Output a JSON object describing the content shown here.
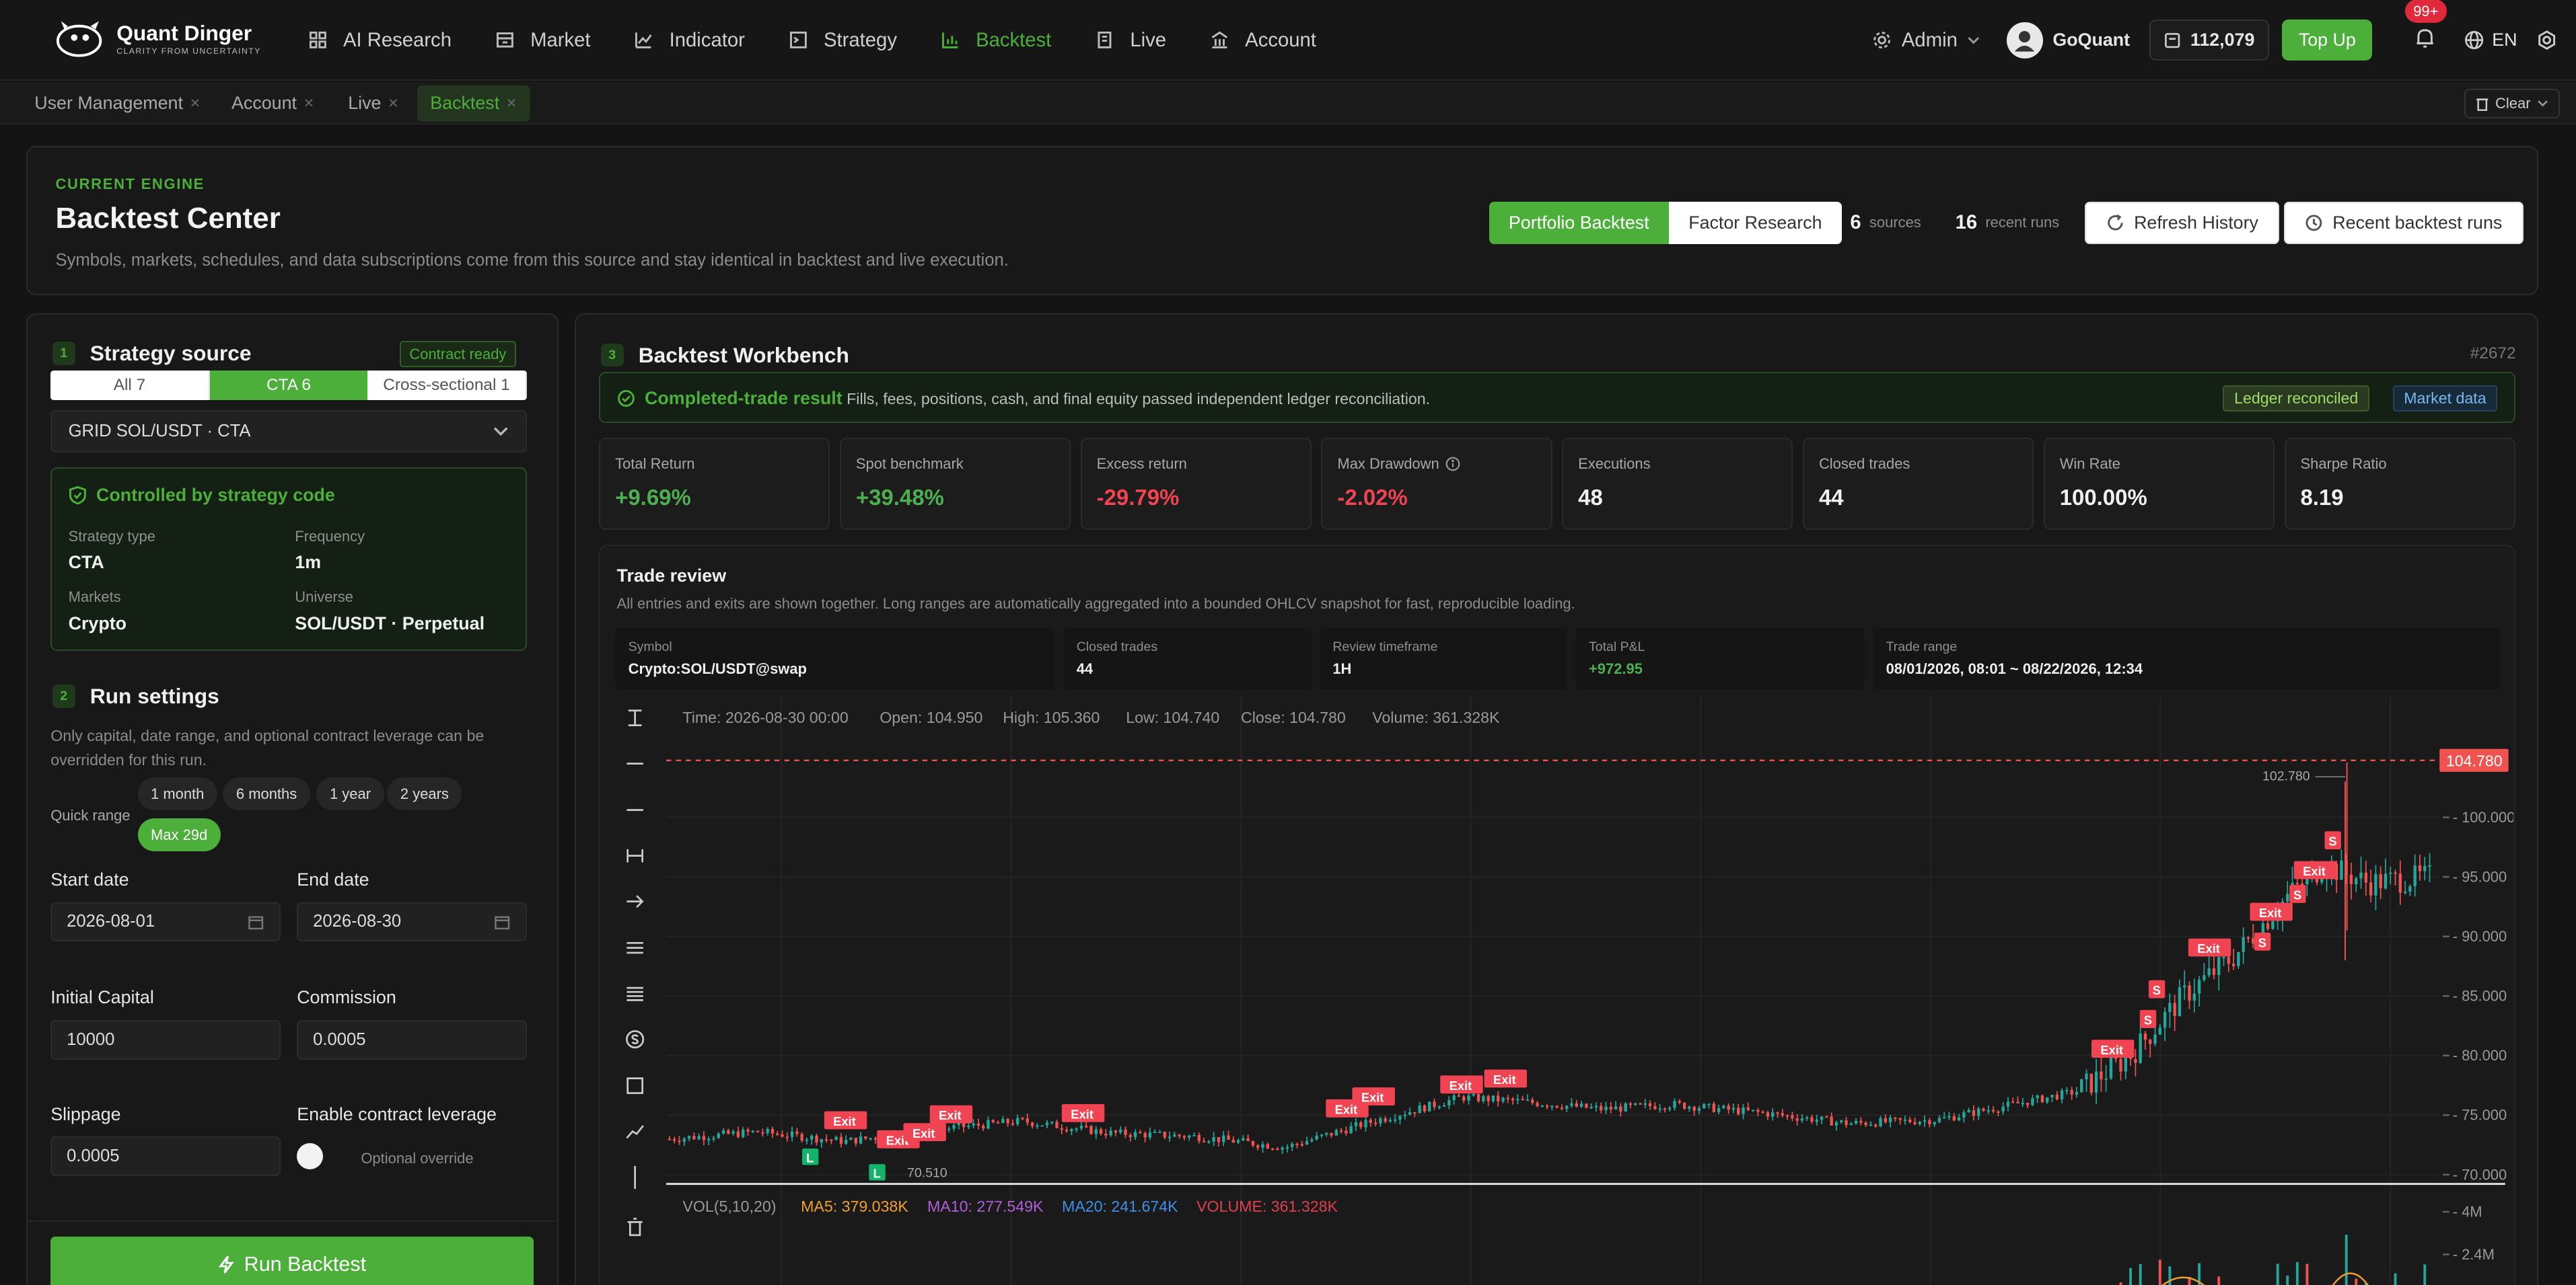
{
  "brand": {
    "name": "Quant Dinger",
    "tagline": "CLARITY FROM UNCERTAINTY"
  },
  "nav": [
    {
      "label": "AI Research",
      "icon": "grid-icon"
    },
    {
      "label": "Market",
      "icon": "store-icon"
    },
    {
      "label": "Indicator",
      "icon": "line-chart-icon"
    },
    {
      "label": "Strategy",
      "icon": "terminal-icon"
    },
    {
      "label": "Backtest",
      "icon": "bar-chart-icon"
    },
    {
      "label": "Live",
      "icon": "building-icon"
    },
    {
      "label": "Account",
      "icon": "bank-icon"
    }
  ],
  "topbar": {
    "admin": "Admin",
    "user": "GoQuant",
    "credits": "112,079",
    "topup": "Top Up",
    "notifications": "99+",
    "language": "EN"
  },
  "tabs": [
    "User Management",
    "Account",
    "Live",
    "Backtest"
  ],
  "clear_label": "Clear",
  "header": {
    "engine": "CURRENT ENGINE",
    "title": "Backtest Center",
    "subtitle": "Symbols, markets, schedules, and data subscriptions come from this source and stay identical in backtest and live execution.",
    "modes": [
      "Portfolio Backtest",
      "Factor Research"
    ],
    "sources_count": "6",
    "sources_label": "sources",
    "runs_count": "16",
    "runs_label": "recent runs",
    "refresh": "Refresh History",
    "recent": "Recent backtest runs"
  },
  "source": {
    "step": "1",
    "title": "Strategy source",
    "status": "Contract ready",
    "filters": [
      "All 7",
      "CTA 6",
      "Cross-sectional 1"
    ],
    "selected": "GRID SOL/USDT · CTA",
    "controlled": "Controlled by strategy code",
    "fields": [
      {
        "k": "Strategy type",
        "v": "CTA"
      },
      {
        "k": "Frequency",
        "v": "1m"
      },
      {
        "k": "Markets",
        "v": "Crypto"
      },
      {
        "k": "Universe",
        "v": "SOL/USDT · Perpetual"
      }
    ]
  },
  "run": {
    "step": "2",
    "title": "Run settings",
    "hint": "Only capital, date range, and optional contract leverage can be overridden for this run.",
    "quick_range": "Quick range",
    "ranges": [
      "1 month",
      "6 months",
      "1 year",
      "2 years",
      "Max 29d"
    ],
    "start_label": "Start date",
    "start": "2026-08-01",
    "end_label": "End date",
    "end": "2026-08-30",
    "capital_label": "Initial Capital",
    "capital": "10000",
    "commission_label": "Commission",
    "commission": "0.0005",
    "slippage_label": "Slippage",
    "slippage": "0.0005",
    "leverage_label": "Enable contract leverage",
    "leverage_hint": "Optional override",
    "run_button": "Run Backtest"
  },
  "workbench": {
    "step": "3",
    "title": "Backtest Workbench",
    "run_id": "#2672",
    "result_title": "Completed-trade result",
    "result_text": "Fills, fees, positions, cash, and final equity passed independent ledger reconciliation.",
    "tags": [
      "Ledger reconciled",
      "Market data"
    ],
    "metrics": [
      {
        "label": "Total Return",
        "value": "+9.69%",
        "color": "#4caf50"
      },
      {
        "label": "Spot benchmark",
        "value": "+39.48%",
        "color": "#4caf50"
      },
      {
        "label": "Excess return",
        "value": "-29.79%",
        "color": "#f04452"
      },
      {
        "label": "Max Drawdown",
        "value": "-2.02%",
        "color": "#f04452"
      },
      {
        "label": "Executions",
        "value": "48",
        "color": "#f0f0f0"
      },
      {
        "label": "Closed trades",
        "value": "44",
        "color": "#f0f0f0"
      },
      {
        "label": "Win Rate",
        "value": "100.00%",
        "color": "#f0f0f0"
      },
      {
        "label": "Sharpe Ratio",
        "value": "8.19",
        "color": "#f0f0f0"
      }
    ],
    "review_title": "Trade review",
    "review_sub": "All entries and exits are shown together. Long ranges are automatically aggregated into a bounded OHLCV snapshot for fast, reproducible loading.",
    "info": [
      {
        "k": "Symbol",
        "v": "Crypto:SOL/USDT@swap"
      },
      {
        "k": "Closed trades",
        "v": "44"
      },
      {
        "k": "Review timeframe",
        "v": "1H"
      },
      {
        "k": "Total P&L",
        "v": "+972.95"
      },
      {
        "k": "Trade range",
        "v": "08/01/2026, 08:01 ~ 08/22/2026, 12:34"
      }
    ]
  },
  "chart_data": {
    "type": "candlestick",
    "ohlc_label": {
      "time": "Time: 2026-08-30 00:00",
      "open": "Open: 104.950",
      "high": "High: 105.360",
      "low": "Low: 104.740",
      "close": "Close: 104.780",
      "volume": "Volume: 361.328K"
    },
    "last_price": "104.780",
    "max_label": "102.780",
    "min_label": "70.510",
    "y_ticks": [
      "100.000",
      "95.000",
      "90.000",
      "85.000",
      "80.000",
      "75.000",
      "70.000"
    ],
    "ylim": [
      69.5,
      106
    ],
    "close_path": [
      [
        0,
        73.0
      ],
      [
        0.05,
        73.6
      ],
      [
        0.1,
        72.8
      ],
      [
        0.15,
        73.8
      ],
      [
        0.2,
        74.5
      ],
      [
        0.25,
        73.5
      ],
      [
        0.3,
        73.2
      ],
      [
        0.35,
        72.3
      ],
      [
        0.4,
        74.5
      ],
      [
        0.45,
        76.5
      ],
      [
        0.48,
        76.2
      ],
      [
        0.53,
        75.5
      ],
      [
        0.57,
        75.9
      ],
      [
        0.62,
        75.2
      ],
      [
        0.67,
        74.3
      ],
      [
        0.72,
        74.6
      ],
      [
        0.76,
        75.8
      ],
      [
        0.8,
        77.0
      ],
      [
        0.83,
        80.0
      ],
      [
        0.86,
        85.0
      ],
      [
        0.89,
        88.5
      ],
      [
        0.92,
        93.5
      ],
      [
        0.94,
        96.0
      ],
      [
        0.965,
        94.5
      ],
      [
        1.0,
        95.0
      ]
    ],
    "markers": [
      {
        "x": 0.1,
        "p": 74.5,
        "label": "Exit",
        "type": "exit"
      },
      {
        "x": 0.13,
        "p": 72.9,
        "label": "Exit",
        "type": "exit"
      },
      {
        "x": 0.145,
        "p": 73.5,
        "label": "Exit",
        "type": "exit"
      },
      {
        "x": 0.16,
        "p": 75.0,
        "label": "Exit",
        "type": "exit"
      },
      {
        "x": 0.235,
        "p": 75.1,
        "label": "Exit",
        "type": "exit"
      },
      {
        "x": 0.385,
        "p": 75.5,
        "label": "Exit",
        "type": "exit"
      },
      {
        "x": 0.4,
        "p": 76.5,
        "label": "Exit",
        "type": "exit"
      },
      {
        "x": 0.45,
        "p": 77.5,
        "label": "Exit",
        "type": "exit"
      },
      {
        "x": 0.475,
        "p": 78.0,
        "label": "Exit",
        "type": "exit"
      },
      {
        "x": 0.82,
        "p": 80.5,
        "label": "Exit",
        "type": "exit"
      },
      {
        "x": 0.84,
        "p": 83.0,
        "label": "S",
        "type": "sell"
      },
      {
        "x": 0.845,
        "p": 85.5,
        "label": "S",
        "type": "sell"
      },
      {
        "x": 0.875,
        "p": 89.0,
        "label": "Exit",
        "type": "exit"
      },
      {
        "x": 0.905,
        "p": 89.5,
        "label": "S",
        "type": "sell"
      },
      {
        "x": 0.91,
        "p": 92.0,
        "label": "Exit",
        "type": "exit"
      },
      {
        "x": 0.925,
        "p": 93.5,
        "label": "S",
        "type": "sell"
      },
      {
        "x": 0.935,
        "p": 95.5,
        "label": "Exit",
        "type": "exit"
      },
      {
        "x": 0.945,
        "p": 98.0,
        "label": "S",
        "type": "sell"
      },
      {
        "x": 0.08,
        "p": 71.5,
        "label": "L",
        "type": "long"
      },
      {
        "x": 0.118,
        "p": 70.2,
        "label": "L",
        "type": "long"
      }
    ],
    "volume": {
      "label": "VOL(5,10,20)",
      "ma5": "MA5: 379.038K",
      "ma10": "MA10: 277.549K",
      "ma20": "MA20: 241.674K",
      "vol": "VOLUME: 361.328K",
      "ticks": [
        "4M",
        "2.4M"
      ]
    }
  },
  "colors": {
    "accent": "#4caf3a",
    "up": "#26a69a",
    "down": "#ef5350",
    "panel": "#181818"
  }
}
